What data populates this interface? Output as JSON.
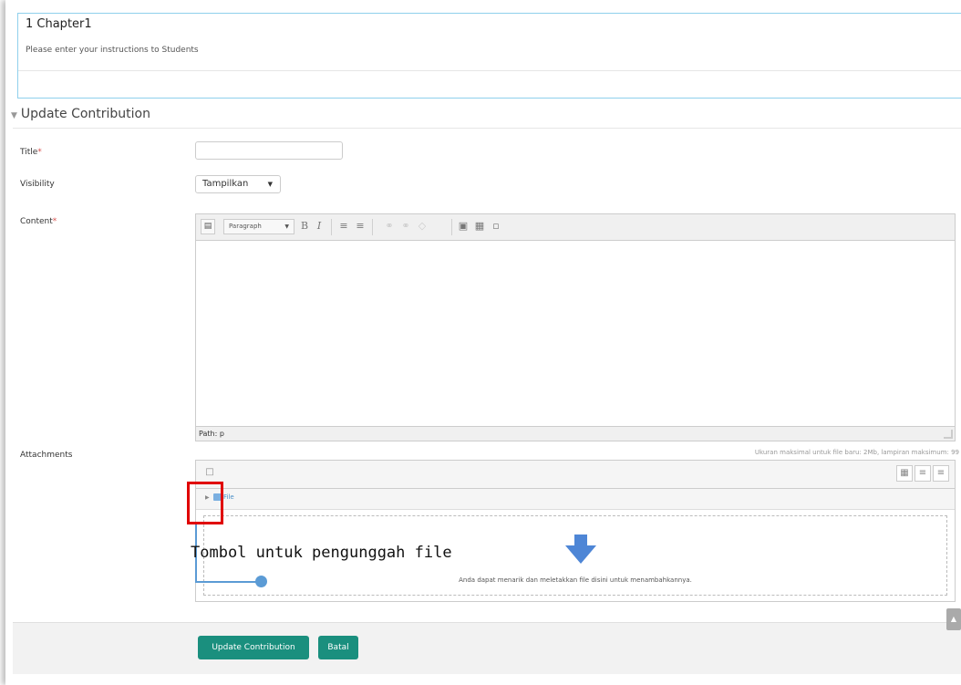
{
  "chapter": {
    "title": "1 Chapter1",
    "instructions": "Please enter your instructions to Students"
  },
  "section": {
    "title": "Update Contribution",
    "collapse_icon": "triangle-down-icon"
  },
  "form": {
    "title_label": "Title",
    "title_value": "",
    "visibility_label": "Visibility",
    "visibility_value": "Tampilkan",
    "content_label": "Content",
    "attachments_label": "Attachments",
    "required_mark": "*"
  },
  "editor": {
    "format_value": "Paragraph",
    "bold": "B",
    "italic": "I",
    "path": "Path: p"
  },
  "filepicker": {
    "max_size": "Ukuran maksimal untuk file baru: 2Mb, lampiran maksimum: 99",
    "path_label": "File",
    "drop_text": "Anda dapat menarik dan meletakkan file disini untuk menambahkannya."
  },
  "annotation": {
    "text": "Tombol untuk pengunggah file",
    "highlight_color": "#e00000",
    "line_color": "#5b9bd5"
  },
  "buttons": {
    "submit": "Update Contribution",
    "cancel": "Batal"
  },
  "colors": {
    "primary_button": "#1a8f7e",
    "required": "#d9534f"
  }
}
